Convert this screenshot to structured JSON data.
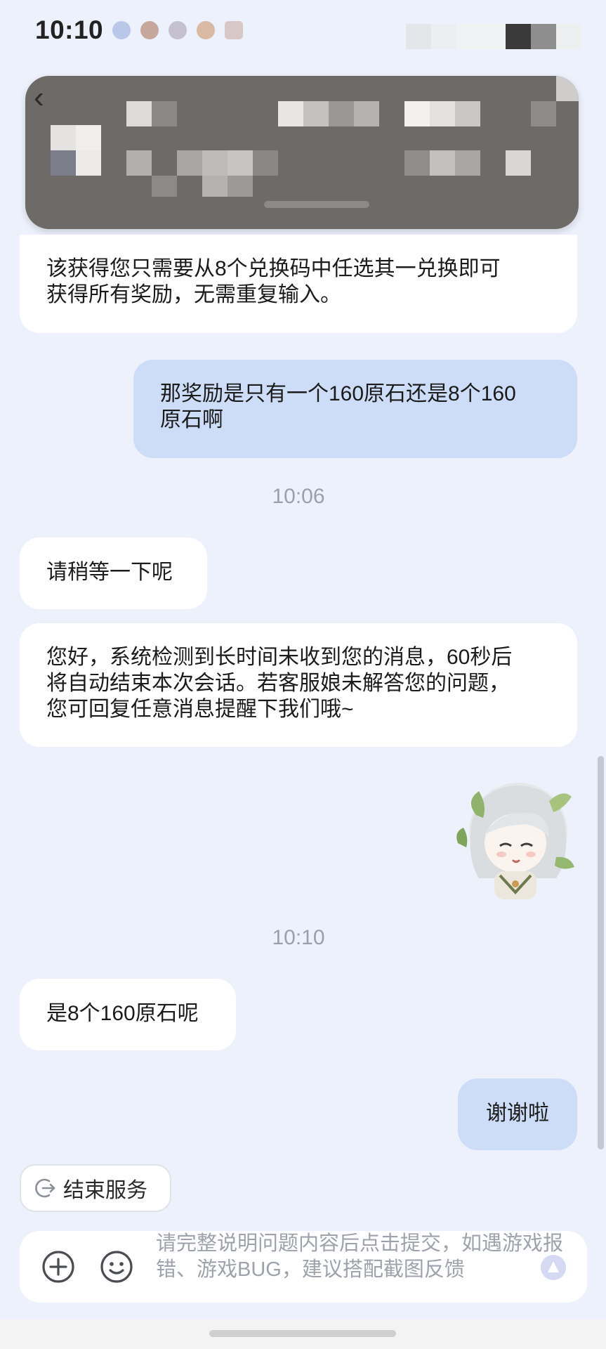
{
  "status_bar": {
    "time": "10:10"
  },
  "messages": [
    {
      "sender": "agent",
      "text": "该获得您只需要从8个兑换码中任选其一兑换即可\n获得所有奖励，无需重复输入。"
    },
    {
      "sender": "user",
      "text": "那奖励是只有一个160原石还是8个160\n原石啊"
    },
    {
      "sender": "agent",
      "text": "请稍等一下呢"
    },
    {
      "sender": "agent",
      "text": "您好，系统检测到长时间未收到您的消息，60秒后\n将自动结束本次会话。若客服娘未解答您的问题，\n您可回复任意消息提醒下我们哦~"
    },
    {
      "sender": "agent",
      "text": "是8个160原石呢"
    },
    {
      "sender": "user",
      "text": "谢谢啦"
    }
  ],
  "timestamps": [
    "10:06",
    "10:10"
  ],
  "end_service": {
    "label": "结束服务",
    "icon": "exit-icon"
  },
  "input": {
    "placeholder": "请完整说明问题内容后点击提交，如遇游戏报错、游戏BUG，建议搭配截图反馈",
    "plus_icon": "plus-circle-icon",
    "emoji_icon": "emoji-icon",
    "send_icon": "send-icon"
  },
  "colors": {
    "background": "#ecf1fb",
    "agent_bubble": "#ffffff",
    "user_bubble": "#cddcf7",
    "timestamp": "#9aa1ad",
    "placeholder": "#9ea3ab"
  }
}
